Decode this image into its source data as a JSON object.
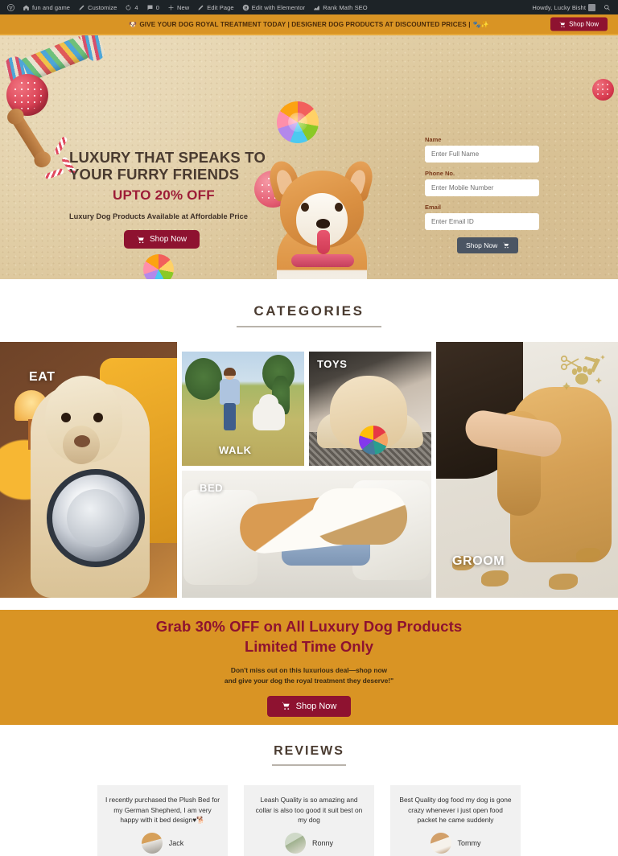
{
  "adminbar": {
    "items": [
      {
        "icon": "wordpress-logo-icon",
        "label": ""
      },
      {
        "icon": "home-icon",
        "label": "fun and game"
      },
      {
        "icon": "pencil-icon",
        "label": "Customize"
      },
      {
        "icon": "refresh-icon",
        "label": "4"
      },
      {
        "icon": "comment-icon",
        "label": "0"
      },
      {
        "icon": "plus-icon",
        "label": "New"
      },
      {
        "icon": "edit-icon",
        "label": "Edit Page"
      },
      {
        "icon": "elementor-icon",
        "label": "Edit with Elementor"
      },
      {
        "icon": "rankmath-icon",
        "label": "Rank Math SEO"
      }
    ],
    "greeting": "Howdy, Lucky Bisht",
    "search_icon": "search-icon"
  },
  "announce": {
    "emoji_left": "🐶",
    "text": "GIVE YOUR DOG ROYAL TREATMENT TODAY | DESIGNER DOG PRODUCTS AT DISCOUNTED PRICES |",
    "emoji_right": "🐾✨",
    "shop_label": "Shop Now"
  },
  "hero": {
    "title": "LUXURY THAT SPEAKS TO YOUR FURRY FRIENDS",
    "offer": "UPTO 20% OFF",
    "desc": "Luxury Dog Products Available at Affordable Price",
    "shop_label": "Shop Now",
    "form": {
      "name_label": "Name",
      "name_placeholder": "Enter Full Name",
      "name_value": "",
      "phone_label": "Phone No.",
      "phone_placeholder": "Enter Mobile Number",
      "phone_value": "",
      "email_label": "Email",
      "email_placeholder": "Enter Email ID",
      "email_value": "",
      "submit_label": "Shop Now"
    }
  },
  "categories": {
    "title": "CATEGORIES",
    "tiles": [
      {
        "label": "EAT"
      },
      {
        "label": "WALK"
      },
      {
        "label": "TOYS"
      },
      {
        "label": "BED"
      },
      {
        "label": "GROOM"
      }
    ]
  },
  "promo": {
    "line1": "Grab 30% OFF on All Luxury Dog Products",
    "line2": "Limited Time Only",
    "sub_line1": "Don't miss out on this luxurious deal—shop now",
    "sub_line2": "and give your dog the royal treatment they deserve!\"",
    "shop_label": "Shop Now"
  },
  "reviews": {
    "title": "REVIEWS",
    "cards": [
      {
        "text": "I recently purchased the Plush Bed for my German Shepherd, I am very happy with it bed design♥🐕",
        "name": "Jack"
      },
      {
        "text": "Leash Quality is so amazing and collar is also too good it suit best on my dog",
        "name": "Ronny"
      },
      {
        "text": "Best Quality dog food my dog is gone crazy whenever i just open food packet he came suddenly",
        "name": "Tommy"
      }
    ]
  },
  "colors": {
    "brand_maroon": "#8e1230",
    "brand_orange": "#d99424",
    "admin_dark": "#1d2327",
    "heading_brown": "#4a3b30",
    "form_button_gray": "#4b5563"
  }
}
